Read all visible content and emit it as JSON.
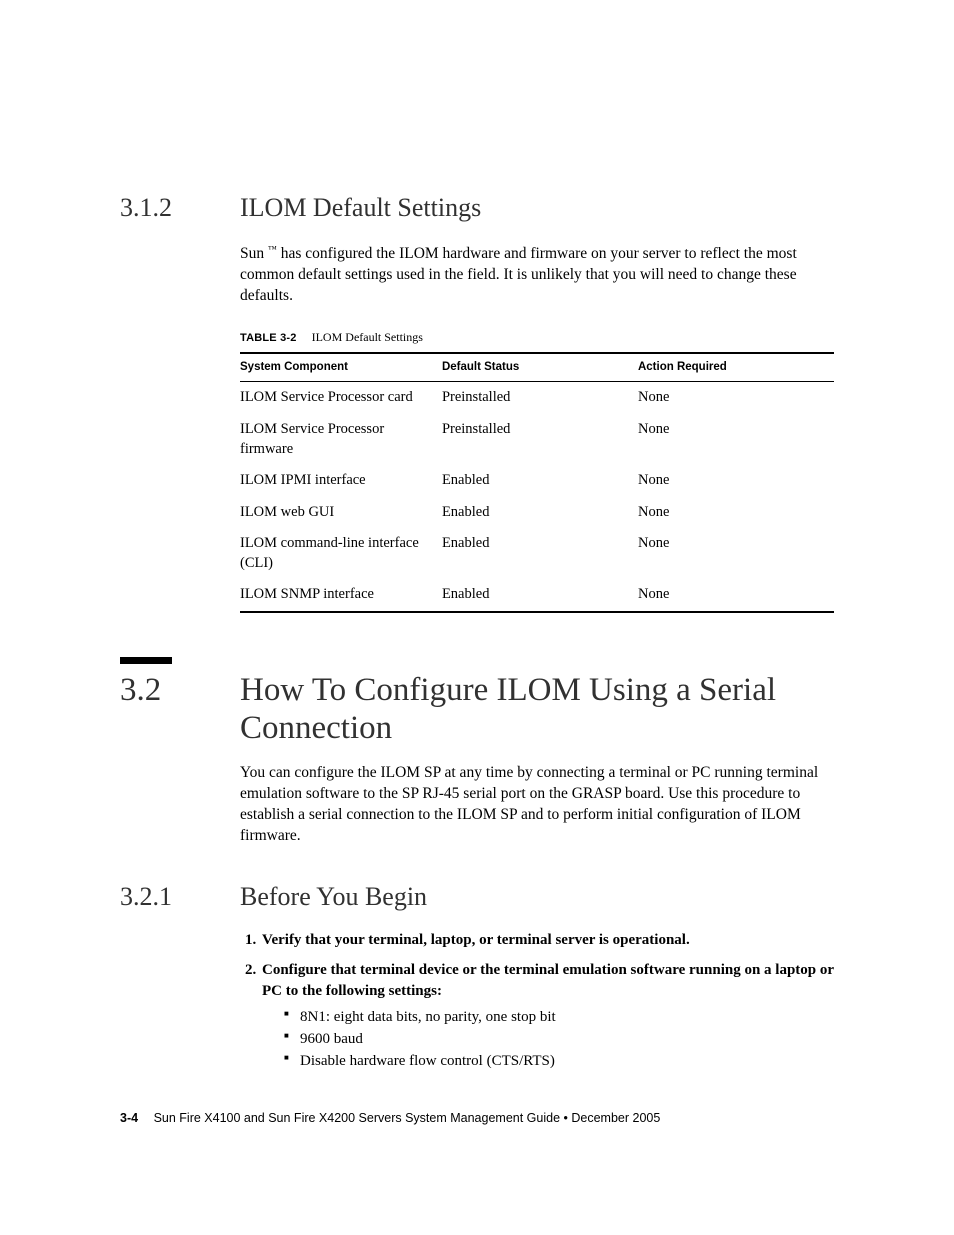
{
  "sec312": {
    "num": "3.1.2",
    "title": "ILOM Default Settings",
    "para_pre": "Sun",
    "para_post": "has configured the ILOM hardware and firmware on your server to reflect the most common default settings used in the field. It is unlikely that you will need to change these defaults."
  },
  "table": {
    "label": "TABLE 3-2",
    "caption": "ILOM Default Settings",
    "headers": {
      "component": "System Component",
      "status": "Default Status",
      "action": "Action Required"
    },
    "rows": [
      {
        "component": "ILOM Service Processor card",
        "status": "Preinstalled",
        "action": "None"
      },
      {
        "component": "ILOM Service Processor firmware",
        "status": "Preinstalled",
        "action": "None"
      },
      {
        "component": "ILOM IPMI interface",
        "status": "Enabled",
        "action": "None"
      },
      {
        "component": "ILOM web GUI",
        "status": "Enabled",
        "action": "None"
      },
      {
        "component": "ILOM command-line interface (CLI)",
        "status": "Enabled",
        "action": "None"
      },
      {
        "component": "ILOM SNMP interface",
        "status": "Enabled",
        "action": "None"
      }
    ]
  },
  "sec32": {
    "num": "3.2",
    "title": "How To Configure ILOM Using a Serial Connection",
    "para": "You can configure the ILOM SP at any time by connecting a terminal or PC running terminal emulation software to the SP RJ-45 serial port on the GRASP board. Use this procedure to establish a serial connection to the ILOM SP and to perform initial configuration of ILOM firmware."
  },
  "sec321": {
    "num": "3.2.1",
    "title": "Before You Begin",
    "steps": [
      "Verify that your terminal, laptop, or terminal server is operational.",
      "Configure that terminal device or the terminal emulation software running on a laptop or PC to the following settings:"
    ],
    "bullets": [
      "8N1: eight data bits, no parity, one stop bit",
      "9600 baud",
      "Disable hardware flow control (CTS/RTS)"
    ]
  },
  "footer": {
    "page": "3-4",
    "text": "Sun Fire X4100 and Sun Fire X4200 Servers System Management Guide • December 2005"
  },
  "tm": "™"
}
